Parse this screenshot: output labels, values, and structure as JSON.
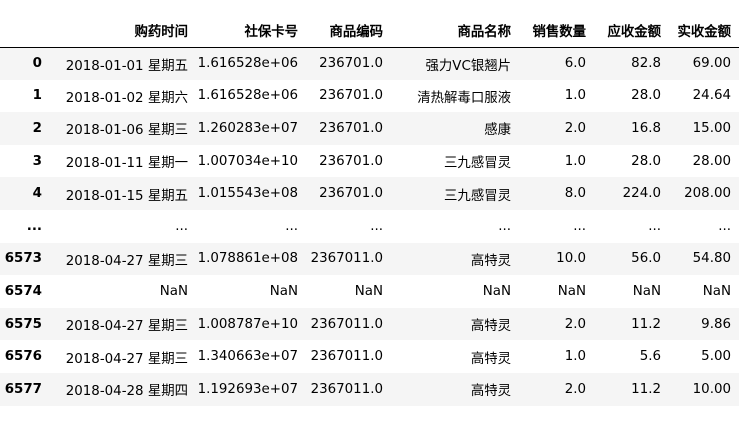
{
  "table": {
    "columns": [
      "",
      "购药时间",
      "社保卡号",
      "商品编码",
      "商品名称",
      "销售数量",
      "应收金额",
      "实收金额"
    ],
    "rows": [
      {
        "index": "0",
        "cells": [
          "2018-01-01 星期五",
          "1.616528e+06",
          "236701.0",
          "强力VC银翘片",
          "6.0",
          "82.8",
          "69.00"
        ]
      },
      {
        "index": "1",
        "cells": [
          "2018-01-02 星期六",
          "1.616528e+06",
          "236701.0",
          "清热解毒口服液",
          "1.0",
          "28.0",
          "24.64"
        ]
      },
      {
        "index": "2",
        "cells": [
          "2018-01-06 星期三",
          "1.260283e+07",
          "236701.0",
          "感康",
          "2.0",
          "16.8",
          "15.00"
        ]
      },
      {
        "index": "3",
        "cells": [
          "2018-01-11 星期一",
          "1.007034e+10",
          "236701.0",
          "三九感冒灵",
          "1.0",
          "28.0",
          "28.00"
        ]
      },
      {
        "index": "4",
        "cells": [
          "2018-01-15 星期五",
          "1.015543e+08",
          "236701.0",
          "三九感冒灵",
          "8.0",
          "224.0",
          "208.00"
        ]
      },
      {
        "index": "...",
        "cells": [
          "...",
          "...",
          "...",
          "...",
          "...",
          "...",
          "..."
        ]
      },
      {
        "index": "6573",
        "cells": [
          "2018-04-27 星期三",
          "1.078861e+08",
          "2367011.0",
          "高特灵",
          "10.0",
          "56.0",
          "54.80"
        ]
      },
      {
        "index": "6574",
        "cells": [
          "NaN",
          "NaN",
          "NaN",
          "NaN",
          "NaN",
          "NaN",
          "NaN"
        ]
      },
      {
        "index": "6575",
        "cells": [
          "2018-04-27 星期三",
          "1.008787e+10",
          "2367011.0",
          "高特灵",
          "2.0",
          "11.2",
          "9.86"
        ]
      },
      {
        "index": "6576",
        "cells": [
          "2018-04-27 星期三",
          "1.340663e+07",
          "2367011.0",
          "高特灵",
          "1.0",
          "5.6",
          "5.00"
        ]
      },
      {
        "index": "6577",
        "cells": [
          "2018-04-28 星期四",
          "1.192693e+07",
          "2367011.0",
          "高特灵",
          "2.0",
          "11.2",
          "10.00"
        ]
      }
    ]
  }
}
